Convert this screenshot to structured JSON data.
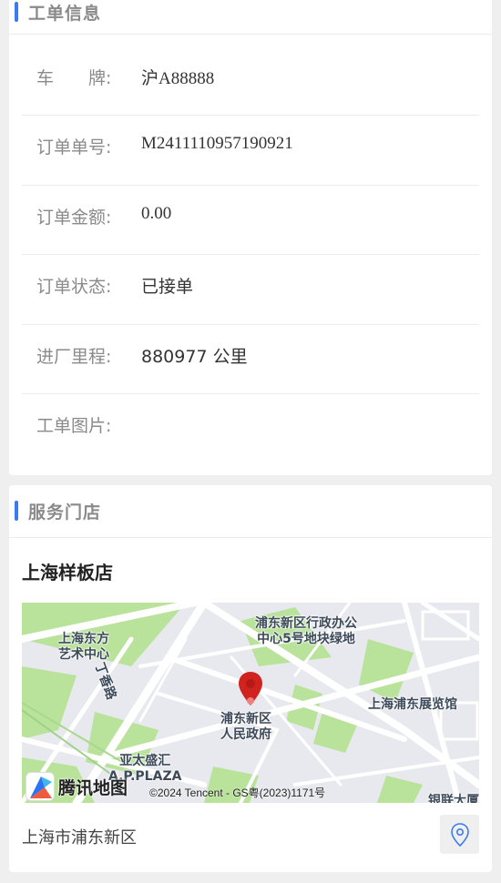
{
  "order_card": {
    "title": "工单信息",
    "rows": [
      {
        "label_a": "车",
        "label_b": "牌:",
        "value": "沪A88888"
      },
      {
        "label": "订单单号:",
        "value": "M2411110957190921"
      },
      {
        "label": "订单金额:",
        "value": "0.00"
      },
      {
        "label": "订单状态:",
        "value": "已接单"
      },
      {
        "label": "进厂里程:",
        "value": "880977 公里"
      },
      {
        "label": "工单图片:",
        "value": ""
      }
    ]
  },
  "store_card": {
    "title": "服务门店",
    "store_name": "上海样板店",
    "address": "上海市浦东新区",
    "map": {
      "labels": {
        "east_art": "上海东方\n艺术中心",
        "admin_center": "浦东新区行政办公\n中心5号地块绿地",
        "road": "丁香路",
        "gov": "浦东新区\n人民政府",
        "exhibition": "上海浦东展览馆",
        "plaza": "亚太盛汇\nA.P.PLAZA",
        "corner": "银联大厦"
      },
      "logo_text": "腾讯地图",
      "copyright": "©2024 Tencent - GS粤(2023)1171号",
      "marker_color": "#d0231f",
      "park_color": "#b9e29a",
      "road_color": "#ffffff"
    }
  },
  "colors": {
    "accent": "#3a7bf0"
  },
  "icons": {
    "location_button": "location-pin-icon",
    "map_marker": "map-marker-icon"
  }
}
